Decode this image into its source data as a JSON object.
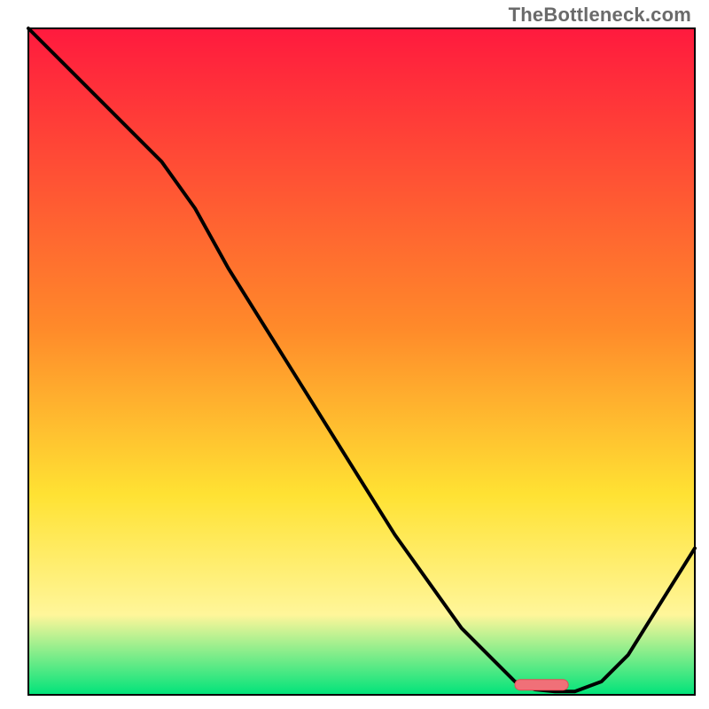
{
  "watermark": "TheBottleneck.com",
  "chart_data": {
    "type": "line",
    "title": "",
    "xlabel": "",
    "ylabel": "",
    "xlim": [
      0,
      100
    ],
    "ylim": [
      0,
      100
    ],
    "grid": false,
    "x": [
      0,
      5,
      10,
      15,
      20,
      25,
      30,
      35,
      40,
      45,
      50,
      55,
      60,
      65,
      70,
      73,
      76,
      79,
      82,
      86,
      90,
      95,
      100
    ],
    "y": [
      100,
      95,
      90,
      85,
      80,
      73,
      64,
      56,
      48,
      40,
      32,
      24,
      17,
      10,
      5,
      2,
      0.8,
      0.5,
      0.5,
      2,
      6,
      14,
      22
    ],
    "marker": {
      "x_start": 73,
      "x_end": 81,
      "y": 1.5
    },
    "colors": {
      "gradient_top": "#ff1a3e",
      "gradient_mid1": "#ff8a2a",
      "gradient_mid2": "#ffe233",
      "gradient_mid3": "#fff69a",
      "gradient_bottom": "#00e37a",
      "curve": "#000000",
      "marker_fill": "#f07078",
      "marker_stroke": "#e24b55"
    }
  }
}
